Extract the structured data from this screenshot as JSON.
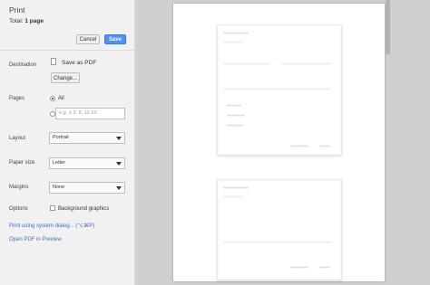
{
  "dialog": {
    "title": "Print",
    "total_label": "Total: ",
    "total_value": "1 page",
    "cancel": "Cancel",
    "save": "Save"
  },
  "destination": {
    "label": "Destination",
    "value": "Save as PDF",
    "change": "Change..."
  },
  "pages": {
    "label": "Pages",
    "all": "All",
    "custom_placeholder": "e.g. 1-5, 8, 11-13"
  },
  "layout": {
    "label": "Layout",
    "value": "Portrait"
  },
  "paper_size": {
    "label": "Paper size",
    "value": "Letter"
  },
  "margins": {
    "label": "Margins",
    "value": "None"
  },
  "options": {
    "label": "Options",
    "background_graphics": "Background graphics"
  },
  "links": {
    "system_dialog": "Print using system dialog... (⌥⌘P)",
    "open_pdf": "Open PDF in Preview"
  },
  "colors": {
    "accent": "#4d90fe",
    "link": "#3d6fc4"
  }
}
